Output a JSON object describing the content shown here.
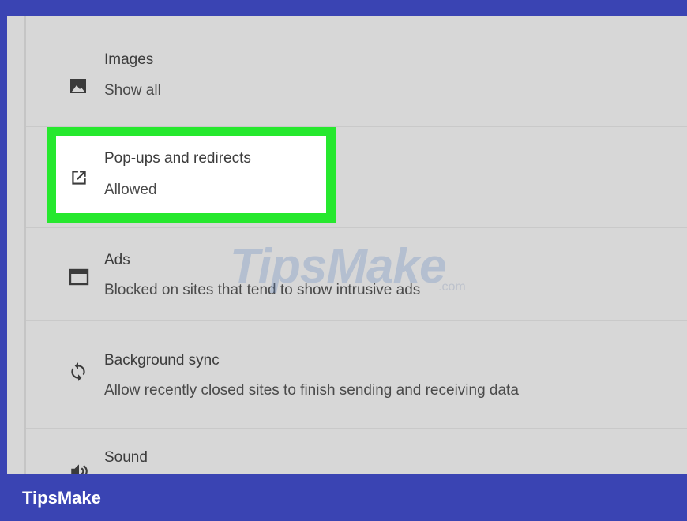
{
  "settings": {
    "items": [
      {
        "title": "Images",
        "subtitle": "Show all",
        "icon": "image-icon"
      },
      {
        "title": "Pop-ups and redirects",
        "subtitle": "Allowed",
        "icon": "open-in-new-icon"
      },
      {
        "title": "Ads",
        "subtitle": "Blocked on sites that tend to show intrusive ads",
        "icon": "browser-window-icon"
      },
      {
        "title": "Background sync",
        "subtitle": "Allow recently closed sites to finish sending and receiving data",
        "icon": "sync-icon"
      },
      {
        "title": "Sound",
        "subtitle": "",
        "icon": "volume-icon"
      }
    ]
  },
  "overlay": {
    "watermark": "TipsMake",
    "watermark_suffix": ".com",
    "highlight_color": "#26e82e"
  },
  "footer": {
    "brand": "TipsMake",
    "background": "#3a44b3"
  }
}
